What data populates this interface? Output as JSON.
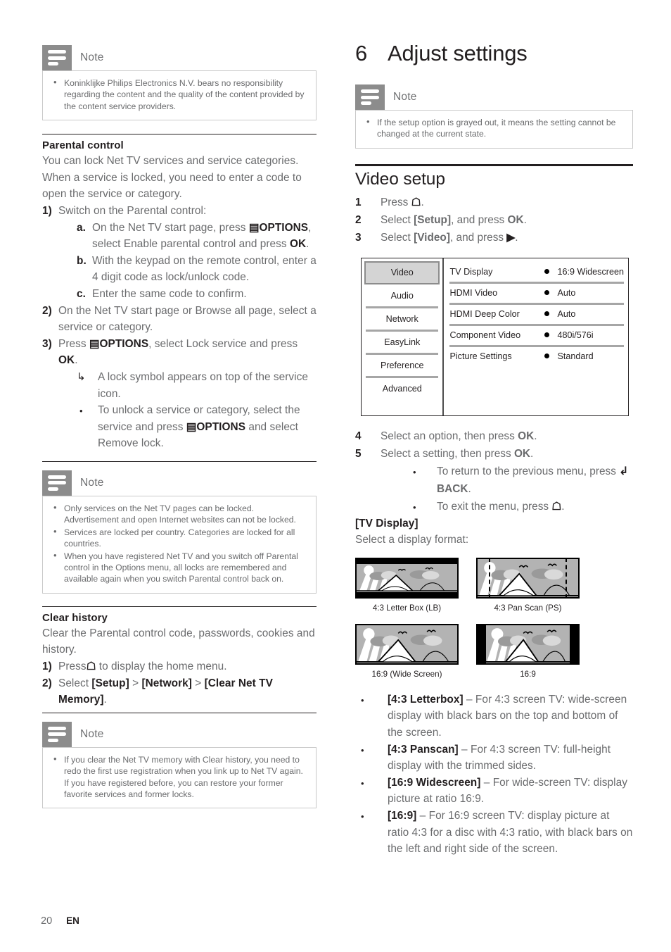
{
  "footer": {
    "page_number": "20",
    "language": "EN"
  },
  "left_column": {
    "note1": {
      "title": "Note",
      "items": [
        "Koninklijke Philips Electronics N.V. bears no responsibility regarding the content and the quality of the content provided by the content service providers."
      ]
    },
    "parental": {
      "heading": "Parental control",
      "intro": "You can lock Net TV services and service categories. When a service is locked, you need to enter a code to open the service or category.",
      "step1_num": "1)",
      "step1": "Switch on the Parental control:",
      "sub_a_num": "a.",
      "sub_a_part1": "On the Net TV start page, press",
      "sub_a_options": "OPTIONS",
      "sub_a_part2": ", select Enable parental control and press",
      "sub_a_ok": "OK",
      "sub_a_end": ".",
      "sub_b_num": "b.",
      "sub_b": "With the keypad on the remote control, enter a 4 digit code as lock/unlock code.",
      "sub_c_num": "c.",
      "sub_c": "Enter the same code to confirm.",
      "step2_num": "2)",
      "step2": "On the Net TV start page or Browse all page, select a service or category.",
      "step3_num": "3)",
      "step3_part1": "Press",
      "step3_options": "OPTIONS",
      "step3_part2": ", select Lock service and press",
      "step3_ok": "OK",
      "step3_end": ".",
      "arrow_item": "A lock symbol appears on top of the service icon.",
      "bullet_part1": "To unlock a service or category, select the service and press",
      "bullet_options": "OPTIONS",
      "bullet_part2": " and select Remove lock."
    },
    "note2": {
      "title": "Note",
      "items": [
        "Only services on the Net TV pages can be locked. Advertisement and open Internet websites can not be locked.",
        "Services are locked per country. Categories are locked for all countries.",
        "When you have registered Net TV and you switch off Parental control in the Options menu, all locks are remembered and available again when you switch Parental control back on."
      ]
    },
    "clear_history": {
      "heading": "Clear history",
      "intro": "Clear the Parental control code, passwords, cookies and history.",
      "step1_num": "1)",
      "step1_part1": "Press",
      "step1_part2": "to display the home menu.",
      "step2_num": "2)",
      "step2_part1": "Select",
      "step2_setup": "[Setup]",
      "step2_gt1": ">",
      "step2_network": "[Network]",
      "step2_gt2": ">",
      "step2_memory": "[Clear Net TV Memory]",
      "step2_end": "."
    },
    "note3": {
      "title": "Note",
      "items": [
        "If you clear the Net TV memory with Clear history, you need to redo the first use registration when you link up to Net TV again. If you have registered before, you can restore your former favorite services and former locks."
      ]
    }
  },
  "right_column": {
    "chapter_number": "6",
    "chapter_title": "Adjust settings",
    "note1": {
      "title": "Note",
      "items": [
        "If the setup option is grayed out, it means the setting cannot be changed at the current state."
      ]
    },
    "video_setup": {
      "heading": "Video setup",
      "step1_num": "1",
      "step1": "Press",
      "step1_end": ".",
      "step2_num": "2",
      "step2_part1": "Select",
      "step2_setup": "[Setup]",
      "step2_part2": ", and press",
      "step2_ok": "OK",
      "step2_end": ".",
      "step3_num": "3",
      "step3_part1": "Select",
      "step3_video": "[Video]",
      "step3_part2": ", and press",
      "step3_end": "."
    },
    "settings_menu": {
      "categories": [
        "Video",
        "Audio",
        "Network",
        "EasyLink",
        "Preference",
        "Advanced"
      ],
      "selected_category": "Video",
      "rows": [
        {
          "label": "TV Display",
          "value": "16:9 Widescreen"
        },
        {
          "label": "HDMI Video",
          "value": "Auto"
        },
        {
          "label": "HDMI Deep Color",
          "value": "Auto"
        },
        {
          "label": "Component Video",
          "value": "480i/576i"
        },
        {
          "label": "Picture Settings",
          "value": "Standard"
        }
      ]
    },
    "steps_after": {
      "step4_num": "4",
      "step4_part1": "Select an option, then press",
      "step4_ok": "OK",
      "step4_end": ".",
      "step5_num": "5",
      "step5_part1": "Select a setting, then press",
      "step5_ok": "OK",
      "step5_end": ".",
      "bullet1_part1": "To return to the previous menu, press",
      "bullet1_back": "BACK",
      "bullet1_end": ".",
      "bullet2_part1": "To exit the menu, press",
      "bullet2_end": "."
    },
    "tv_display": {
      "heading": "[TV Display]",
      "subtitle": "Select a display format:",
      "thumbnails": [
        {
          "caption": "4:3 Letter Box (LB)",
          "mode": "letterbox"
        },
        {
          "caption": "4:3 Pan Scan (PS)",
          "mode": "panscan"
        },
        {
          "caption": "16:9 (Wide Screen)",
          "mode": "widescreen"
        },
        {
          "caption": "16:9",
          "mode": "pillarbox"
        }
      ],
      "bullets": [
        {
          "term": "[4:3 Letterbox]",
          "desc": " – For 4:3 screen TV: wide-screen display with black bars on the top and bottom of the screen."
        },
        {
          "term": "[4:3 Panscan]",
          "desc": " – For 4:3 screen TV: full-height display with the trimmed sides."
        },
        {
          "term": "[16:9 Widescreen]",
          "desc": " – For wide-screen TV: display picture at ratio 16:9."
        },
        {
          "term": "[16:9]",
          "desc": " – For 16:9 screen TV: display picture at ratio 4:3 for a disc with 4:3 ratio, with black bars on the left and right side of the screen."
        }
      ]
    }
  },
  "icons": {
    "options": "options-icon",
    "home": "⌂",
    "back": "↶",
    "play": "▶"
  }
}
